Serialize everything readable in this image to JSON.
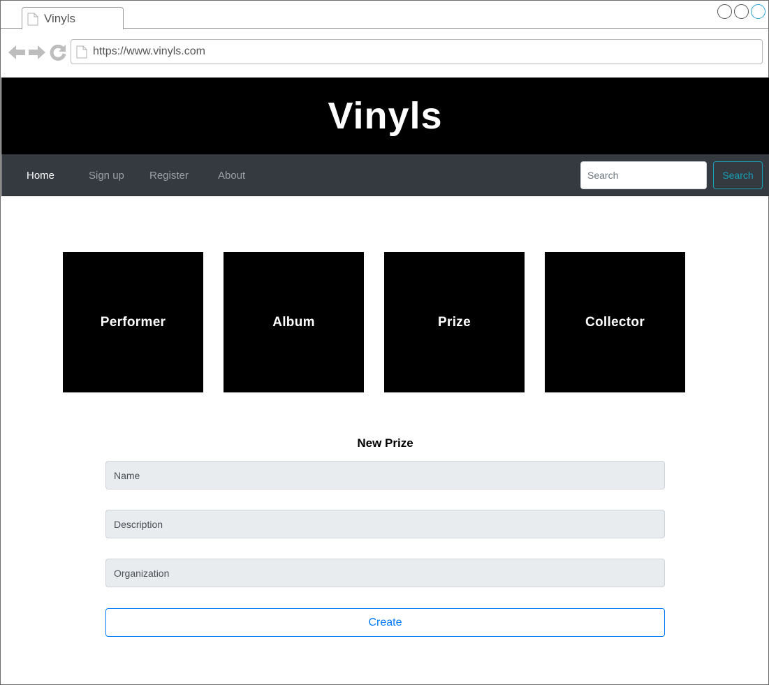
{
  "browser": {
    "tab_title": "Vinyls",
    "url": "https://www.vinyls.com",
    "icons": [
      "document-icon",
      "back-arrow-icon",
      "forward-arrow-icon",
      "reload-icon"
    ]
  },
  "header": {
    "title": "Vinyls"
  },
  "navbar": {
    "links": [
      {
        "label": "Home",
        "active": true
      },
      {
        "label": "Sign up",
        "active": false
      },
      {
        "label": "Register",
        "active": false
      },
      {
        "label": "About",
        "active": false
      }
    ],
    "search": {
      "placeholder": "Search",
      "value": "",
      "button_label": "Search"
    }
  },
  "categories": [
    {
      "label": "Performer"
    },
    {
      "label": "Album"
    },
    {
      "label": "Prize"
    },
    {
      "label": "Collector"
    }
  ],
  "form": {
    "title": "New Prize",
    "fields": [
      {
        "placeholder": "Name",
        "value": ""
      },
      {
        "placeholder": "Description",
        "value": ""
      },
      {
        "placeholder": "Organization",
        "value": ""
      }
    ],
    "submit_label": "Create"
  },
  "colors": {
    "header_bg": "#000000",
    "navbar_bg": "#343a40",
    "search_button": "#17a2b8",
    "create_button": "#007bff",
    "field_bg": "#e9ecef"
  }
}
